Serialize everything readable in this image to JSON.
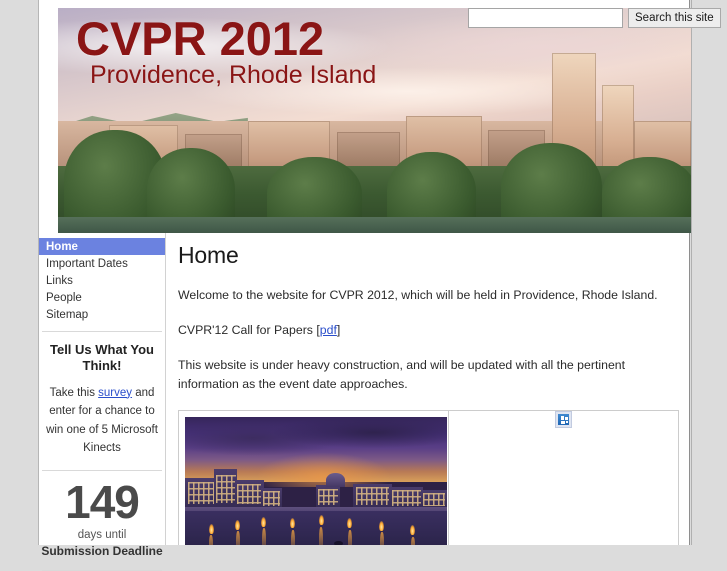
{
  "banner": {
    "title": "CVPR 2012",
    "subtitle": "Providence, Rhode Island",
    "alt": "Providence skyline panorama"
  },
  "search": {
    "value": "",
    "placeholder": "",
    "button_label": "Search this site"
  },
  "sidebar": {
    "nav": [
      {
        "label": "Home",
        "active": true
      },
      {
        "label": "Important Dates",
        "active": false
      },
      {
        "label": "Links",
        "active": false
      },
      {
        "label": "People",
        "active": false
      },
      {
        "label": "Sitemap",
        "active": false
      }
    ],
    "survey_box": {
      "heading": "Tell Us What You Think!",
      "text_before": "Take this ",
      "link_label": "survey",
      "text_after": " and enter for a chance to win one of 5 Microsoft Kinects"
    },
    "countdown": {
      "number": "149",
      "label_line1": "days until",
      "label_line2": "Submission Deadline"
    }
  },
  "main": {
    "title": "Home",
    "paragraph1": "Welcome to the website for CVPR 2012, which will be held in Providence, Rhode Island.",
    "cfp_text": "CVPR'12 Call for Papers [",
    "cfp_link": "pdf",
    "cfp_text_end": "]",
    "paragraph2": "This website is under heavy construction, and will be updated with all the pertinent information as the event date approaches.",
    "photo_alt": "WaterFire Providence at night",
    "broken_image_label": ""
  },
  "colors": {
    "nav_active_bg": "#6b82e0",
    "title_red": "#8a1515",
    "link_blue": "#2a4ecb",
    "page_bg": "#dcdcdc"
  }
}
